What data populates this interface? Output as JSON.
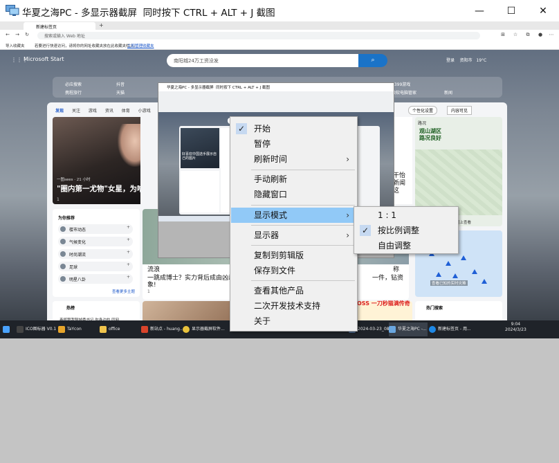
{
  "window": {
    "title": "华夏之海PC - 多显示器截屏  同时按下 CTRL + ALT + J 截图",
    "minimize_symbol": "—",
    "maximize_symbol": "☐",
    "close_symbol": "✕"
  },
  "browser": {
    "tab_title": "新建标签页",
    "new_tab_symbol": "+",
    "close_tab_symbol": "×",
    "address_placeholder": "搜索或输入 Web 地址",
    "favbar_import": "导入收藏夹",
    "favbar_text": "若要进行快速访问，请将你的网址收藏夹放在此收藏夹栏上。",
    "favbar_link": "立即管理收藏夹"
  },
  "msn": {
    "brand": "Microsoft Start",
    "search_text": "南阳城24万工资没发",
    "login": "登录",
    "city": "资阳市",
    "temperature": "19°C",
    "quicklinks": [
      "必应搜索",
      "抖音",
      "携程旅行",
      "天猫",
      "4399游戏",
      "微软电脑管家",
      "新闻"
    ],
    "feed_tabs": [
      "发现",
      "关注",
      "游戏",
      "资讯",
      "体育",
      "小游戏",
      "资"
    ],
    "personalize": "个性化设置",
    "content_visible": "内容可见",
    "hero_meta": "一图sees · 21 小时",
    "hero_title": "\"圈内第一尤物\"女星，为啥耶",
    "hero_likes": "1",
    "side_title": "为你推荐",
    "side_items": [
      "楼市动态",
      "气候变化",
      "时尚潮流",
      "足球",
      "明星八卦"
    ],
    "side_more": "查看更多主题",
    "hot_title": "热榜",
    "hot_first": "毒贩跟我聊城委书记 你身边的 同网",
    "mid_left_1": "流浪",
    "mid_left_2": "一跳成博士？实力背后成由凶悉",
    "mid_left_3": "象!",
    "mid_right_1": "称",
    "mid_right_2": "一件，钻资",
    "mid_likes": "1",
    "right_text": [
      "干怡",
      "新闻",
      "这"
    ],
    "ad_text": "OSS 一刀秒猫满传奇",
    "weather_header": "路况",
    "weather_title": [
      "观山湖区",
      "路况良好"
    ],
    "weather_more": "在地图上查看",
    "map_caption": "查看已知的实时灾难",
    "hot_search_title": "热门搜索"
  },
  "preview": {
    "title": "华夏之海PC - 多显示器截屏  同时按下 CTRL + ALT + J 截图",
    "hero_text": "好喜欢中国选手展示自己的图片"
  },
  "taskbar": {
    "items": [
      "ICO图标器 V0.1",
      "TaYcon",
      "office",
      "新站点 - huang...",
      "显示器截屏软件...",
      "2024-03-23_08...",
      "华夏之海PC -...",
      "新建标签页 - 用..."
    ],
    "search_text": "南阳城24万工资没发",
    "time": "9:04",
    "date": "2024/3/23",
    "lang": "中"
  },
  "context_menu": {
    "items": [
      {
        "label": "开始",
        "checked": true,
        "submenu": false
      },
      {
        "label": "暂停",
        "checked": false,
        "submenu": false
      },
      {
        "label": "刷新时间",
        "checked": false,
        "submenu": true
      },
      {
        "label": "手动刷新",
        "checked": false,
        "submenu": false
      },
      {
        "label": "隐藏窗口",
        "checked": false,
        "submenu": false
      },
      {
        "label": "显示模式",
        "checked": false,
        "submenu": true,
        "highlighted": true
      },
      {
        "label": "显示器",
        "checked": false,
        "submenu": true
      },
      {
        "label": "复制到剪辑版",
        "checked": false,
        "submenu": false
      },
      {
        "label": "保存到文件",
        "checked": false,
        "submenu": false
      },
      {
        "label": "查看其他产品",
        "checked": false,
        "submenu": false
      },
      {
        "label": "二次开发技术支持",
        "checked": false,
        "submenu": false
      },
      {
        "label": "关于",
        "checked": false,
        "submenu": false
      }
    ],
    "check_symbol": "✓",
    "submenu_symbol": "›"
  },
  "display_mode_submenu": {
    "items": [
      {
        "label": "1 : 1",
        "checked": false
      },
      {
        "label": "按比例调整",
        "checked": true
      },
      {
        "label": "自由调整",
        "checked": false
      }
    ]
  },
  "colors": {
    "menu_highlight": "#91c9f7",
    "menu_check_bg": "#c6d9f1",
    "empty_area": "#c4c4c4",
    "accent": "#1a73c8"
  }
}
